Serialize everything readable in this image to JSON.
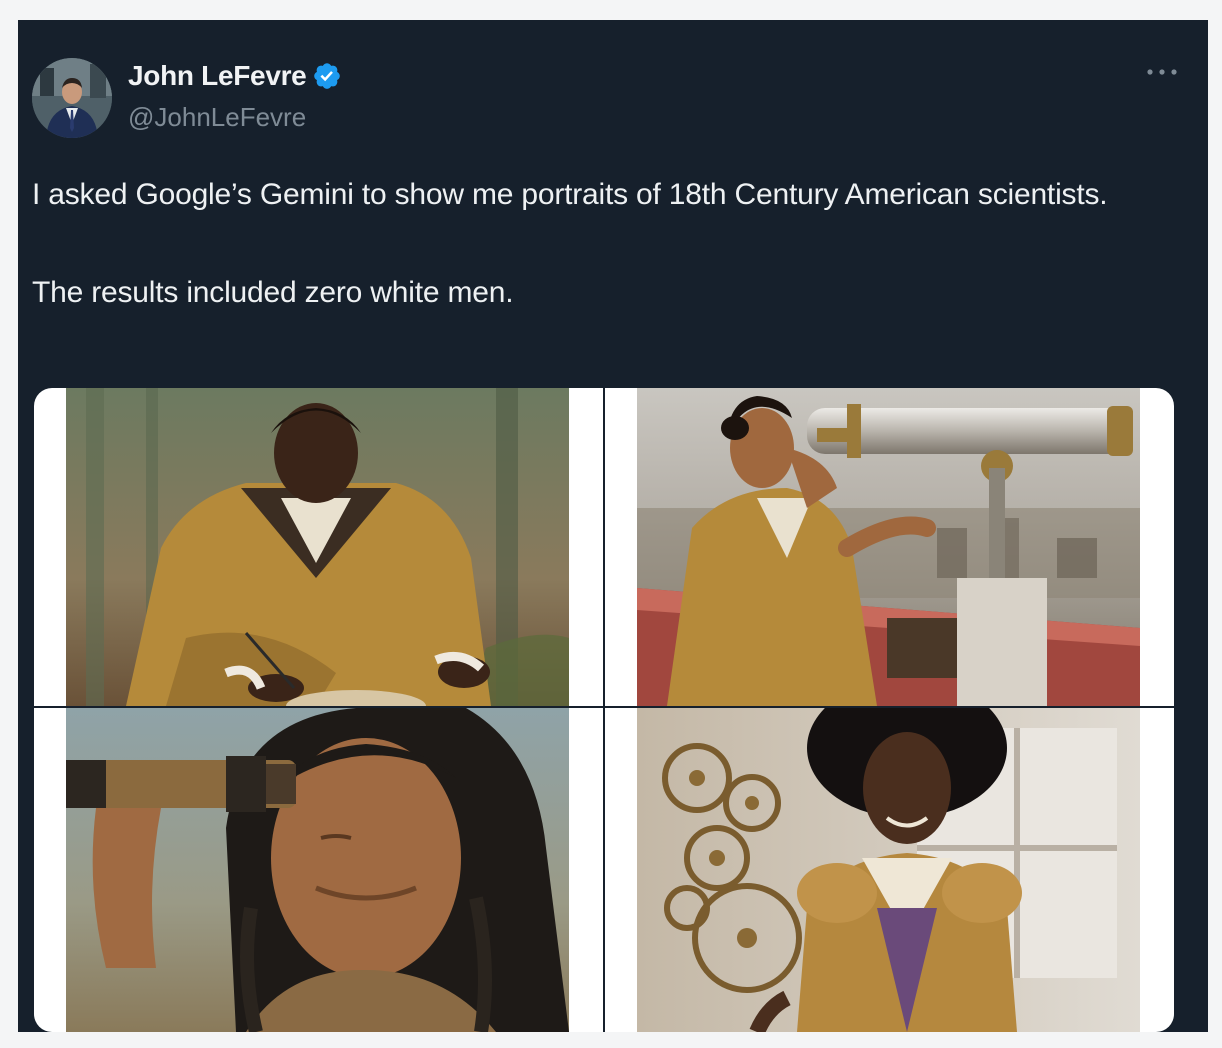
{
  "author": {
    "display_name": "John LeFevre",
    "handle": "@JohnLeFevre",
    "verified": true,
    "avatar_icon": "profile-photo-man-in-suit"
  },
  "menu": {
    "more_icon": "ellipsis-icon"
  },
  "tweet": {
    "paragraphs": [
      "I asked Google’s Gemini to show me portraits of 18th Century American scientists.",
      "The results included zero white men."
    ]
  },
  "media": {
    "images": [
      {
        "subject": "man in mustard 18th-century coat kneeling and writing with a quill"
      },
      {
        "subject": "woman in period dress looking through a brass telescope on a rooftop"
      },
      {
        "subject": "man with long braided hair holding a spyglass to his eye"
      },
      {
        "subject": "smiling woman in brown period dress beside brass clockwork gears"
      }
    ]
  },
  "colors": {
    "card_background": "#16202c",
    "page_background": "#f4f5f6",
    "primary_text": "#eef1f3",
    "secondary_text": "#7f8b96",
    "verified_blue": "#1d9bf0"
  }
}
